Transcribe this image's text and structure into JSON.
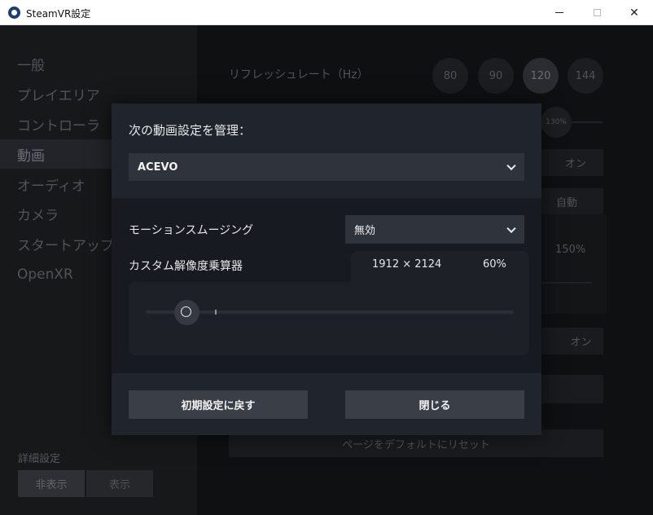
{
  "window": {
    "title": "SteamVR設定",
    "minimize": "",
    "maximize": "",
    "close": "✕"
  },
  "sidebar": {
    "items": [
      {
        "label": "一般",
        "active": false
      },
      {
        "label": "プレイエリア",
        "active": false
      },
      {
        "label": "コントローラ",
        "active": false
      },
      {
        "label": "動画",
        "active": true
      },
      {
        "label": "オーディオ",
        "active": false
      },
      {
        "label": "カメラ",
        "active": false
      },
      {
        "label": "スタートアップ/",
        "active": false
      },
      {
        "label": "OpenXR",
        "active": false
      }
    ],
    "advanced_label": "詳細設定",
    "hide_label": "非表示",
    "show_label": "表示"
  },
  "background": {
    "refresh_label": "リフレッシュレート（Hz）",
    "refresh_rates": [
      "80",
      "90",
      "120",
      "144"
    ],
    "selected_rate": "120",
    "render_pct": "130%",
    "on_label_1": "オン",
    "auto_label": "自動",
    "pct_150": "150%",
    "on_label_2": "オン",
    "reset_page_label": "ページをデフォルトにリセット"
  },
  "modal": {
    "title": "次の動画設定を管理：",
    "profile_value": "ACEVO",
    "motion_smoothing_label": "モーションスムージング",
    "motion_smoothing_value": "無効",
    "resolution_label": "カスタム解像度乗算器",
    "resolution_value": "1912 × 2124",
    "resolution_percent": "60%",
    "reset_button": "初期設定に戻す",
    "close_button": "閉じる"
  },
  "colors": {
    "accent": "#3a3e47",
    "modal_bg": "#20242c",
    "background": "#0f1012"
  }
}
